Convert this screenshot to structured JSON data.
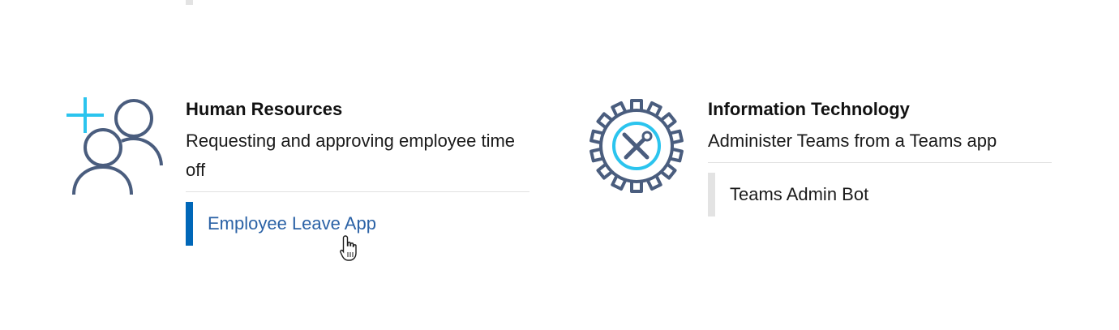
{
  "colors": {
    "accent_blue": "#0067b8",
    "link_blue": "#2b62a6",
    "icon_slate": "#4a5d7e",
    "icon_cyan": "#2bc4ee",
    "divider": "#e1e1e1",
    "inactive_bar": "#e3e3e3"
  },
  "categories": [
    {
      "title": "Human Resources",
      "description": "Requesting and approving employee time off",
      "icon": "people-add-icon",
      "apps": [
        {
          "label": "Employee Leave App",
          "state": "hovered"
        }
      ]
    },
    {
      "title": "Information Technology",
      "description": "Administer Teams from a Teams app",
      "icon": "gear-tools-icon",
      "apps": [
        {
          "label": "Teams Admin Bot",
          "state": "normal"
        }
      ]
    }
  ],
  "cursor": "hand-pointer-cursor-icon"
}
